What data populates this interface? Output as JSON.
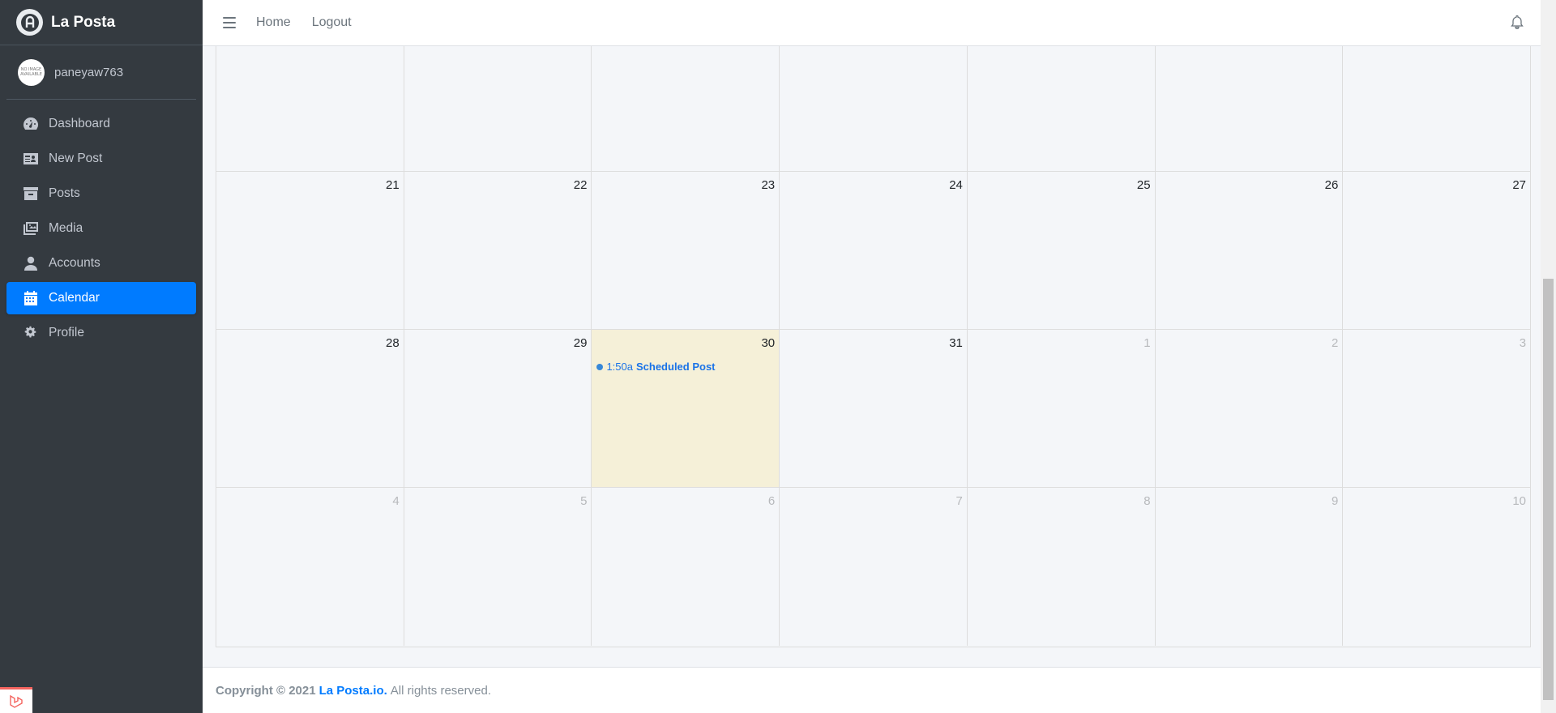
{
  "brand": {
    "name": "La Posta"
  },
  "user": {
    "name": "paneyaw763",
    "avatar_text": "NO IMAGE AVAILABLE"
  },
  "sidebar": {
    "items": [
      {
        "label": "Dashboard",
        "icon": "tachometer-icon"
      },
      {
        "label": "New Post",
        "icon": "id-card-icon"
      },
      {
        "label": "Posts",
        "icon": "archive-icon"
      },
      {
        "label": "Media",
        "icon": "images-icon"
      },
      {
        "label": "Accounts",
        "icon": "user-icon"
      },
      {
        "label": "Calendar",
        "icon": "calendar-icon",
        "active": true
      },
      {
        "label": "Profile",
        "icon": "cogs-icon"
      }
    ]
  },
  "topbar": {
    "home": "Home",
    "logout": "Logout"
  },
  "calendar": {
    "weeks": [
      {
        "days": [
          "",
          "",
          "",
          "",
          "",
          "",
          ""
        ]
      },
      {
        "days": [
          "21",
          "22",
          "23",
          "24",
          "25",
          "26",
          "27"
        ]
      },
      {
        "days": [
          "28",
          "29",
          "30",
          "31",
          "1",
          "2",
          "3"
        ]
      },
      {
        "days": [
          "4",
          "5",
          "6",
          "7",
          "8",
          "9",
          "10"
        ]
      }
    ],
    "event": {
      "time": "1:50a",
      "title": "Scheduled Post"
    }
  },
  "footer": {
    "copyright": "Copyright © 2021",
    "brand": "La Posta.io.",
    "rest": "All rights reserved."
  },
  "colors": {
    "sidebar": "#343a40",
    "accent": "#007bff",
    "today": "#f5f0d8"
  }
}
